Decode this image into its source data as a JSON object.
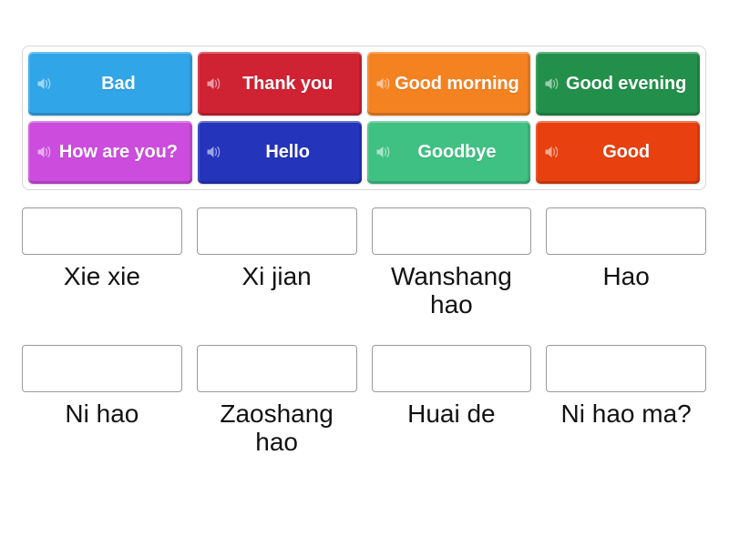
{
  "tile_bank": {
    "icon": "speaker-icon",
    "rows": [
      [
        {
          "label": "Bad",
          "color": "#30a5e8"
        },
        {
          "label": "Thank you",
          "color": "#cf2233"
        },
        {
          "label": "Good morning",
          "color": "#f58220"
        },
        {
          "label": "Good evening",
          "color": "#22904a"
        }
      ],
      [
        {
          "label": "How are you?",
          "color": "#cc4cdd"
        },
        {
          "label": "Hello",
          "color": "#2434bb"
        },
        {
          "label": "Goodbye",
          "color": "#3fc183"
        },
        {
          "label": "Good",
          "color": "#e8400f"
        }
      ]
    ]
  },
  "answer_grid": {
    "rows": [
      [
        {
          "prompt": "Xie xie"
        },
        {
          "prompt": "Xi jian"
        },
        {
          "prompt": "Wanshang hao"
        },
        {
          "prompt": "Hao"
        }
      ],
      [
        {
          "prompt": "Ni hao"
        },
        {
          "prompt": "Zaoshang hao"
        },
        {
          "prompt": "Huai de"
        },
        {
          "prompt": "Ni hao ma?"
        }
      ]
    ]
  }
}
